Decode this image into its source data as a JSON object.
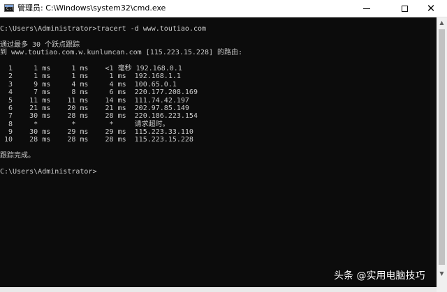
{
  "window": {
    "title": "管理员: C:\\Windows\\system32\\cmd.exe",
    "icon": "cmd-icon",
    "controls": {
      "minimize": "minimize-icon",
      "maximize": "maximize-icon",
      "close": "close-icon",
      "close_glyph": "✕"
    }
  },
  "console": {
    "lines": [
      "C:\\Users\\Administrator>tracert -d www.toutiao.com",
      "",
      "通过最多 30 个跃点跟踪",
      "到 www.toutiao.com.w.kunluncan.com [115.223.15.228] 的路由:",
      "",
      "  1     1 ms     1 ms    <1 毫秒 192.168.0.1",
      "  2     1 ms     1 ms     1 ms  192.168.1.1",
      "  3     9 ms     4 ms     4 ms  100.65.0.1",
      "  4     7 ms     8 ms     6 ms  220.177.208.169",
      "  5    11 ms    11 ms    14 ms  111.74.42.197",
      "  6    21 ms    20 ms    21 ms  202.97.85.149",
      "  7    30 ms    28 ms    28 ms  220.186.223.154",
      "  8     *        *        *     请求超时。",
      "  9    30 ms    29 ms    29 ms  115.223.33.110",
      " 10    28 ms    28 ms    28 ms  115.223.15.228",
      "",
      "跟踪完成。",
      "",
      "C:\\Users\\Administrator>"
    ],
    "text_color": "#cccccc",
    "background": "#0c0c0c"
  },
  "watermark": {
    "text": "头条 @实用电脑技巧"
  },
  "scrollbar": {
    "up_glyph": "▲",
    "down_glyph": "▼"
  }
}
